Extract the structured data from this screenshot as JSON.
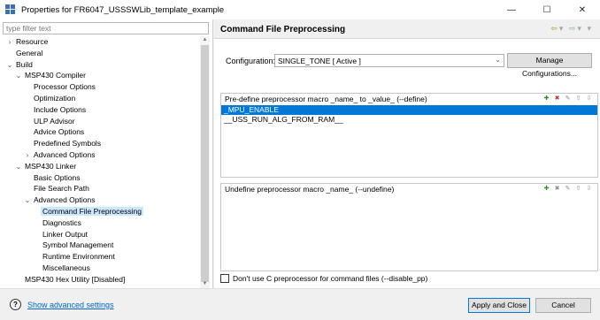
{
  "window": {
    "title": "Properties for FR6047_USSSWLib_template_example",
    "controls": {
      "minimize": "—",
      "maximize": "☐",
      "close": "✕"
    }
  },
  "sidebar": {
    "filter_placeholder": "type filter text",
    "items": [
      {
        "label": "Resource",
        "level": 0,
        "twisty": "›",
        "selected": false
      },
      {
        "label": "General",
        "level": 0,
        "twisty": "",
        "selected": false
      },
      {
        "label": "Build",
        "level": 0,
        "twisty": "⌄",
        "selected": false
      },
      {
        "label": "MSP430 Compiler",
        "level": 1,
        "twisty": "⌄",
        "selected": false
      },
      {
        "label": "Processor Options",
        "level": 2,
        "twisty": "",
        "selected": false
      },
      {
        "label": "Optimization",
        "level": 2,
        "twisty": "",
        "selected": false
      },
      {
        "label": "Include Options",
        "level": 2,
        "twisty": "",
        "selected": false
      },
      {
        "label": "ULP Advisor",
        "level": 2,
        "twisty": "",
        "selected": false
      },
      {
        "label": "Advice Options",
        "level": 2,
        "twisty": "",
        "selected": false
      },
      {
        "label": "Predefined Symbols",
        "level": 2,
        "twisty": "",
        "selected": false
      },
      {
        "label": "Advanced Options",
        "level": 2,
        "twisty": "›",
        "selected": false
      },
      {
        "label": "MSP430 Linker",
        "level": 1,
        "twisty": "⌄",
        "selected": false
      },
      {
        "label": "Basic Options",
        "level": 2,
        "twisty": "",
        "selected": false
      },
      {
        "label": "File Search Path",
        "level": 2,
        "twisty": "",
        "selected": false
      },
      {
        "label": "Advanced Options",
        "level": 2,
        "twisty": "⌄",
        "selected": false
      },
      {
        "label": "Command File Preprocessing",
        "level": 3,
        "twisty": "",
        "selected": true
      },
      {
        "label": "Diagnostics",
        "level": 3,
        "twisty": "",
        "selected": false
      },
      {
        "label": "Linker Output",
        "level": 3,
        "twisty": "",
        "selected": false
      },
      {
        "label": "Symbol Management",
        "level": 3,
        "twisty": "",
        "selected": false
      },
      {
        "label": "Runtime Environment",
        "level": 3,
        "twisty": "",
        "selected": false
      },
      {
        "label": "Miscellaneous",
        "level": 3,
        "twisty": "",
        "selected": false
      },
      {
        "label": "MSP430 Hex Utility  [Disabled]",
        "level": 1,
        "twisty": "",
        "selected": false
      }
    ]
  },
  "main": {
    "page_title": "Command File Preprocessing",
    "nav_icons": [
      "back-arrow-icon",
      "dropdown-icon",
      "forward-arrow-icon",
      "dropdown-icon",
      "menu-icon"
    ],
    "configuration": {
      "label": "Configuration:",
      "value": "SINGLE_TONE  [ Active ]",
      "manage_button": "Manage Configurations..."
    },
    "define_panel": {
      "header": "Pre-define preprocessor macro _name_ to _value_ (--define)",
      "items": [
        {
          "text": "_MPU_ENABLE",
          "selected": true
        },
        {
          "text": "__USS_RUN_ALG_FROM_RAM__",
          "selected": false
        }
      ]
    },
    "undefine_panel": {
      "header": "Undefine preprocessor macro _name_ (--undefine)",
      "items": []
    },
    "disable_pp_checkbox": {
      "label": "Don't use C preprocessor for command files (--disable_pp)",
      "checked": false
    }
  },
  "footer": {
    "advanced_link": "Show advanced settings",
    "apply_close": "Apply and Close",
    "cancel": "Cancel"
  },
  "colors": {
    "selection": "#0078d7",
    "tree_selection": "#cce8ff",
    "link": "#0066cc"
  }
}
